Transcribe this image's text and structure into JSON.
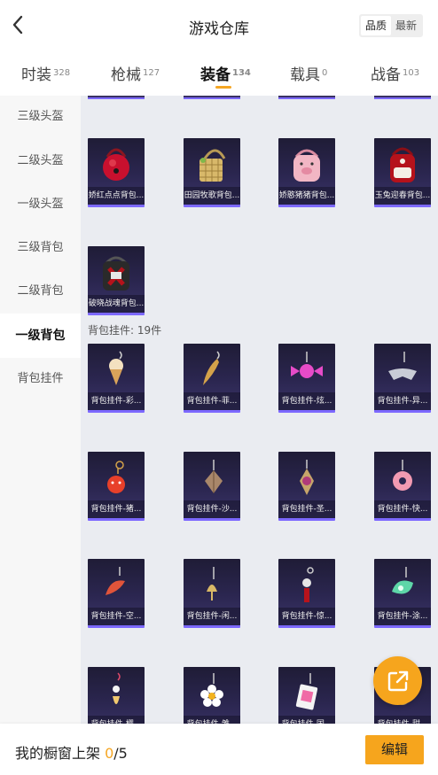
{
  "header": {
    "title": "游戏仓库",
    "sort_options": [
      "品质",
      "最新"
    ],
    "active_sort": 0
  },
  "tabs": [
    {
      "label": "时装",
      "count": "328"
    },
    {
      "label": "枪械",
      "count": "127"
    },
    {
      "label": "装备",
      "count": "134"
    },
    {
      "label": "载具",
      "count": "0"
    },
    {
      "label": "战备",
      "count": "103"
    }
  ],
  "active_tab": "装备",
  "sidebar": {
    "items": [
      {
        "label": "三级头盔"
      },
      {
        "label": "二级头盔"
      },
      {
        "label": "一级头盔"
      },
      {
        "label": "三级背包"
      },
      {
        "label": "二级背包"
      },
      {
        "label": "一级背包"
      },
      {
        "label": "背包挂件"
      }
    ],
    "active": "一级背包"
  },
  "backpacks": [
    {
      "label": "娇红点点背包...",
      "icon": "red-round-backpack-icon",
      "color": "#c8102e"
    },
    {
      "label": "田园牧歌背包...",
      "icon": "woven-basket-backpack-icon",
      "color": "#d8b86a"
    },
    {
      "label": "娇憨猪猪背包...",
      "icon": "pink-pig-backpack-icon",
      "color": "#f2b6c4"
    },
    {
      "label": "玉兔迎春背包...",
      "icon": "red-rabbit-backpack-icon",
      "color": "#b5121b"
    },
    {
      "label": "破晓战魂背包...",
      "icon": "dark-red-backpack-icon",
      "color": "#2a2a2a"
    }
  ],
  "charms_section": {
    "label": "背包挂件: 19件"
  },
  "charms": [
    {
      "label": "背包挂件-彩...",
      "icon": "ice-cream-charm-icon",
      "color": "#f3e1c0"
    },
    {
      "label": "背包挂件-菲...",
      "icon": "golden-blade-charm-icon",
      "color": "#d4a24a"
    },
    {
      "label": "背包挂件-炫...",
      "icon": "candy-charm-icon",
      "color": "#e64bc8"
    },
    {
      "label": "背包挂件-异...",
      "icon": "silver-wing-charm-icon",
      "color": "#c9ccd6"
    },
    {
      "label": "背包挂件-猪...",
      "icon": "pig-charm-icon",
      "color": "#e8402a"
    },
    {
      "label": "背包挂件-沙...",
      "icon": "gem-charm-icon",
      "color": "#a9876a"
    },
    {
      "label": "背包挂件-圣...",
      "icon": "crystal-charm-icon",
      "color": "#b03a7a"
    },
    {
      "label": "背包挂件-快...",
      "icon": "pink-donut-charm-icon",
      "color": "#f29ab2"
    },
    {
      "label": "背包挂件-空...",
      "icon": "shrimp-charm-icon",
      "color": "#e0543a"
    },
    {
      "label": "背包挂件-闲...",
      "icon": "bell-charm-icon",
      "color": "#d9b866"
    },
    {
      "label": "背包挂件-惊...",
      "icon": "red-tassel-charm-icon",
      "color": "#b8131c"
    },
    {
      "label": "背包挂件-涂...",
      "icon": "green-shell-charm-icon",
      "color": "#5ed6a8"
    },
    {
      "label": "背包挂件-樱...",
      "icon": "feather-charm-icon",
      "color": "#f1c96f"
    },
    {
      "label": "背包挂件-雏...",
      "icon": "daisy-charm-icon",
      "color": "#ffffff"
    },
    {
      "label": "背包挂件-国...",
      "icon": "card-charm-icon",
      "color": "#f06aa6"
    },
    {
      "label": "背包挂件-甜...",
      "icon": "charm-icon",
      "color": "#c9a35a"
    }
  ],
  "bottom": {
    "text": "我的橱窗上架 ",
    "current": "0",
    "total": "/5",
    "edit_label": "编辑"
  },
  "icons": {
    "back": "back-arrow-icon",
    "share": "share-icon"
  }
}
